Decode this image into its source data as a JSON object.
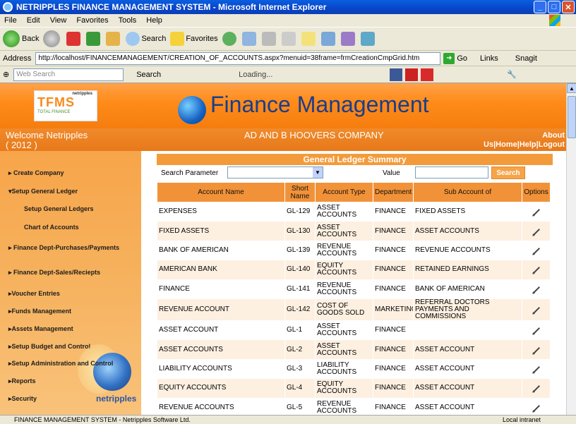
{
  "window": {
    "title": "NETRIPPLES FINANCE MANAGEMENT SYSTEM - Microsoft Internet Explorer",
    "controls": [
      "_",
      "□",
      "✕"
    ]
  },
  "menu": [
    "File",
    "Edit",
    "View",
    "Favorites",
    "Tools",
    "Help"
  ],
  "toolbar": {
    "back": "Back",
    "search": "Search",
    "favorites": "Favorites"
  },
  "address": {
    "label": "Address",
    "url": "http://localhost/FINANCEMANAGEMENT/CREATION_OF_ACCOUNTS.aspx?menuid=38frame=frmCreationCmpGrid.htm",
    "go": "Go",
    "links": "Links",
    "snagit": "Snagit"
  },
  "searchbar": {
    "placeholder": "Web Search",
    "search": "Search",
    "loading": "Loading..."
  },
  "banner": {
    "title": "Finance Management",
    "logo": "TFMS",
    "logo_sub": "TOTAL FINANCE",
    "logo_brand": "netripples"
  },
  "welcome": {
    "line1": "Welcome  Netripples",
    "line2": "( 2012 )",
    "company": "AD AND B HOOVERS COMPANY",
    "about": "About",
    "links": [
      "Us",
      "Home",
      "Help",
      "Logout"
    ]
  },
  "sidebar": {
    "items": [
      "Create Company",
      "Setup General Ledger",
      "Setup General Ledgers",
      "Chart of Accounts",
      "Finance Dept-Purchases/Payments",
      "Finance Dept-Sales/Reciepts",
      "Voucher Entries",
      "Funds Management",
      "Assets Management",
      "Setup Budget and Control",
      "Setup Administration and Control",
      "Reports",
      "Security"
    ],
    "brand": "netripples"
  },
  "panel": {
    "title": "General Ledger Summary",
    "search_label": "Search Parameter",
    "value_label": "Value",
    "search_button": "Search",
    "columns": [
      "Account Name",
      "Short Name",
      "Account Type",
      "Department",
      "Sub Account of",
      "Options"
    ],
    "rows": [
      [
        "EXPENSES",
        "GL-129",
        "ASSET ACCOUNTS",
        "FINANCE",
        "FIXED ASSETS"
      ],
      [
        "FIXED ASSETS",
        "GL-130",
        "ASSET ACCOUNTS",
        "FINANCE",
        "ASSET ACCOUNTS"
      ],
      [
        "BANK OF AMERICAN",
        "GL-139",
        "REVENUE ACCOUNTS",
        "FINANCE",
        "REVENUE ACCOUNTS"
      ],
      [
        "AMERICAN BANK",
        "GL-140",
        "EQUITY ACCOUNTS",
        "FINANCE",
        "RETAINED EARNINGS"
      ],
      [
        "FINANCE",
        "GL-141",
        "REVENUE ACCOUNTS",
        "FINANCE",
        "BANK OF AMERICAN"
      ],
      [
        "REVENUE ACCOUNT",
        "GL-142",
        "COST OF GOODS SOLD",
        "MARKETING",
        "REFERRAL DOCTORS PAYMENTS AND COMMISSIONS"
      ],
      [
        "ASSET ACCOUNT",
        "GL-1",
        "ASSET ACCOUNTS",
        "FINANCE",
        ""
      ],
      [
        "ASSET ACCOUNTS",
        "GL-2",
        "ASSET ACCOUNTS",
        "FINANCE",
        "ASSET ACCOUNT"
      ],
      [
        "LIABILITY ACCOUNTS",
        "GL-3",
        "LIABILITY ACCOUNTS",
        "FINANCE",
        "ASSET ACCOUNT"
      ],
      [
        "EQUITY ACCOUNTS",
        "GL-4",
        "EQUITY ACCOUNTS",
        "FINANCE",
        "ASSET ACCOUNT"
      ],
      [
        "REVENUE ACCOUNTS",
        "GL-5",
        "REVENUE ACCOUNTS",
        "FINANCE",
        "ASSET ACCOUNT"
      ]
    ]
  },
  "status": {
    "text": "FINANCE MANAGEMENT SYSTEM - Netripples Software Ltd.",
    "zone": "Local intranet"
  }
}
